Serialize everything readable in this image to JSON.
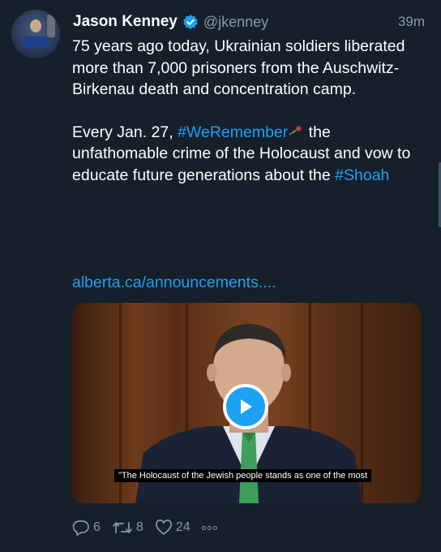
{
  "tweet": {
    "name": "Jason Kenney",
    "handle": "@jkenney",
    "time": "39m",
    "para1": "75 years ago today, Ukrainian soldiers liberated more than 7,000 prisoners from the Auschwitz-Birkenau death and concentration camp.",
    "para2_a": "Every Jan. 27, ",
    "hashtag1": "#WeRemember",
    "para2_b": " the unfathomable crime of the Holocaust and vow to educate future generations about the ",
    "hashtag2": "#Shoah",
    "url": "alberta.ca/announcements....",
    "video_caption": "\"The Holocaust of the Jewish people stands as one of the most",
    "replies": "6",
    "retweets": "8",
    "likes": "24"
  },
  "icons": {
    "verified": "verified-badge-icon",
    "rose": "rose-emoji",
    "play": "play-icon",
    "reply": "reply-icon",
    "retweet": "retweet-icon",
    "like": "heart-icon",
    "more": "more-icon"
  },
  "colors": {
    "background": "#15202b",
    "link": "#1da1f2",
    "secondary": "#8899a6"
  }
}
